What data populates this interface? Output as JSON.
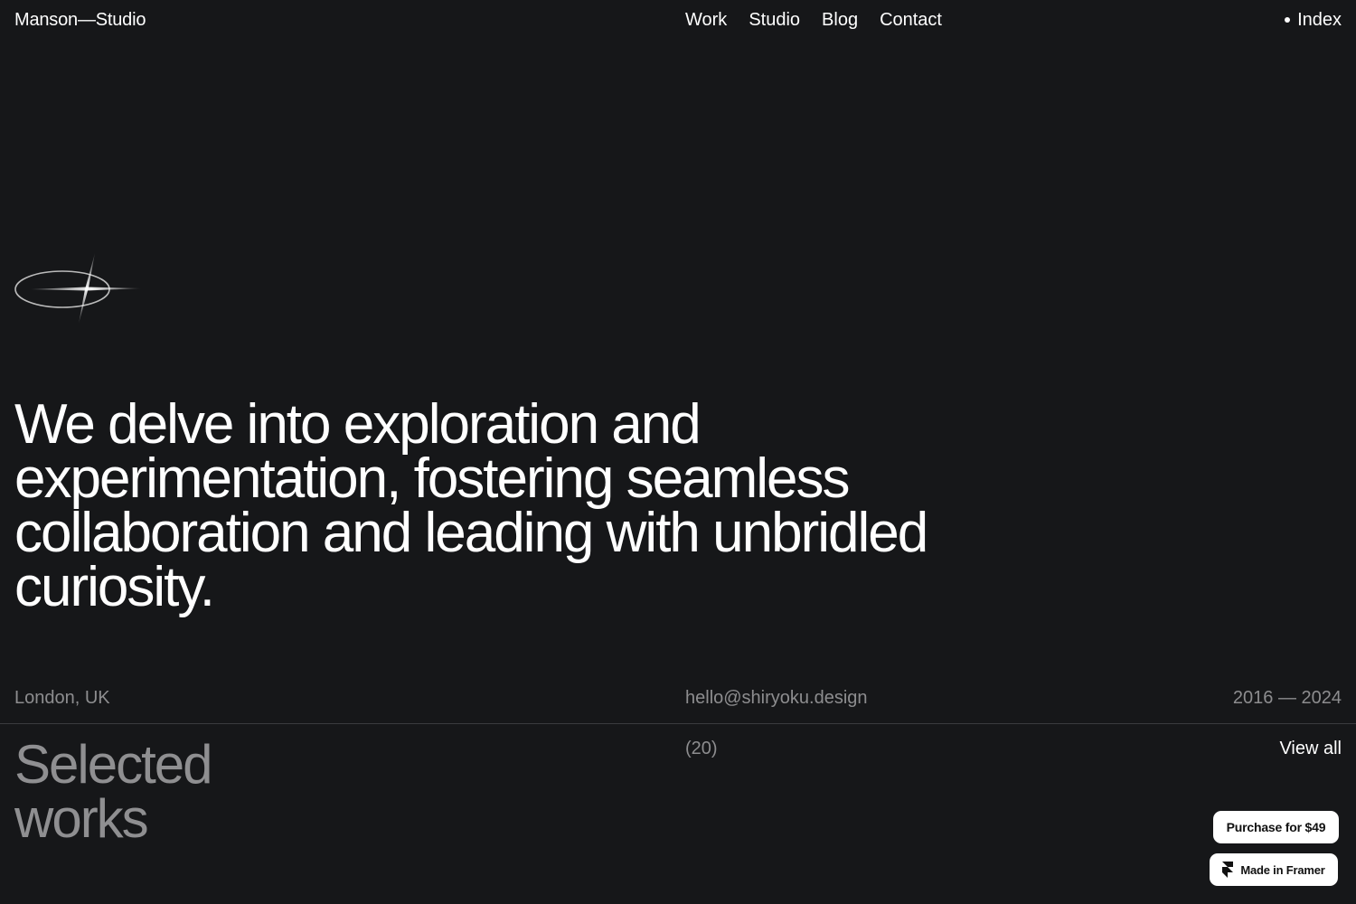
{
  "header": {
    "brand": "Manson—Studio",
    "nav": {
      "work": "Work",
      "studio": "Studio",
      "blog": "Blog",
      "contact": "Contact"
    },
    "index_label": "Index"
  },
  "hero": {
    "line1": "We delve into exploration and",
    "line2": "experimentation, fostering seamless",
    "line3": "collaboration and leading with unbridled",
    "line4": "curiosity."
  },
  "info": {
    "location": "London, UK",
    "email": "hello@shiryoku.design",
    "years": "2016 — 2024"
  },
  "works": {
    "title_line1": "Selected",
    "title_line2": "works",
    "count": "(20)",
    "view_all": "View all"
  },
  "badges": {
    "purchase": "Purchase for $49",
    "framer": "Made in Framer"
  },
  "colors": {
    "background": "#161719",
    "text": "#ffffff",
    "muted": "#8d8d8f",
    "button_bg": "#ffffff"
  },
  "icons": {
    "logo": "orbit-star-logo-icon",
    "index_dot": "dot-icon",
    "framer": "framer-logo-icon"
  }
}
